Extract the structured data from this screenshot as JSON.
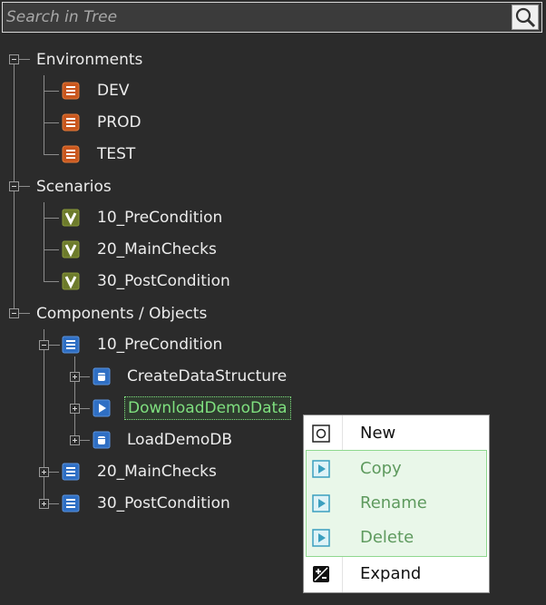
{
  "search": {
    "placeholder": "Search in Tree"
  },
  "icons": {
    "search": "magnifier-icon",
    "environment": "list-doc-icon",
    "scenario": "checkmark-v-icon",
    "component": "list-doc-icon",
    "datastructure": "cylinder-icon",
    "download": "play-arrow-icon"
  },
  "colors": {
    "env_icon": "#c9571e",
    "scenario_icon": "#6d7b2c",
    "component_icon": "#2f6fc4",
    "selected_text": "#7fe07f"
  },
  "tree": {
    "environments": {
      "label": "Environments",
      "children": [
        "DEV",
        "PROD",
        "TEST"
      ]
    },
    "scenarios": {
      "label": "Scenarios",
      "children": [
        "10_PreCondition",
        "20_MainChecks",
        "30_PostCondition"
      ]
    },
    "components": {
      "label": "Components / Objects",
      "children": [
        {
          "label": "10_PreCondition",
          "children": [
            "CreateDataStructure",
            "DownloadDemoData",
            "LoadDemoDB"
          ]
        },
        {
          "label": "20_MainChecks"
        },
        {
          "label": "30_PostCondition"
        }
      ]
    }
  },
  "context_menu": {
    "items": [
      {
        "label": "New",
        "icon": "circle-in-square-icon",
        "enabled": true
      },
      {
        "label": "Copy",
        "icon": "play-square-icon",
        "enabled": false
      },
      {
        "label": "Rename",
        "icon": "play-square-icon",
        "enabled": false
      },
      {
        "label": "Delete",
        "icon": "play-square-icon",
        "enabled": false
      },
      {
        "label": "Expand",
        "icon": "plus-minus-icon",
        "enabled": true
      }
    ]
  }
}
